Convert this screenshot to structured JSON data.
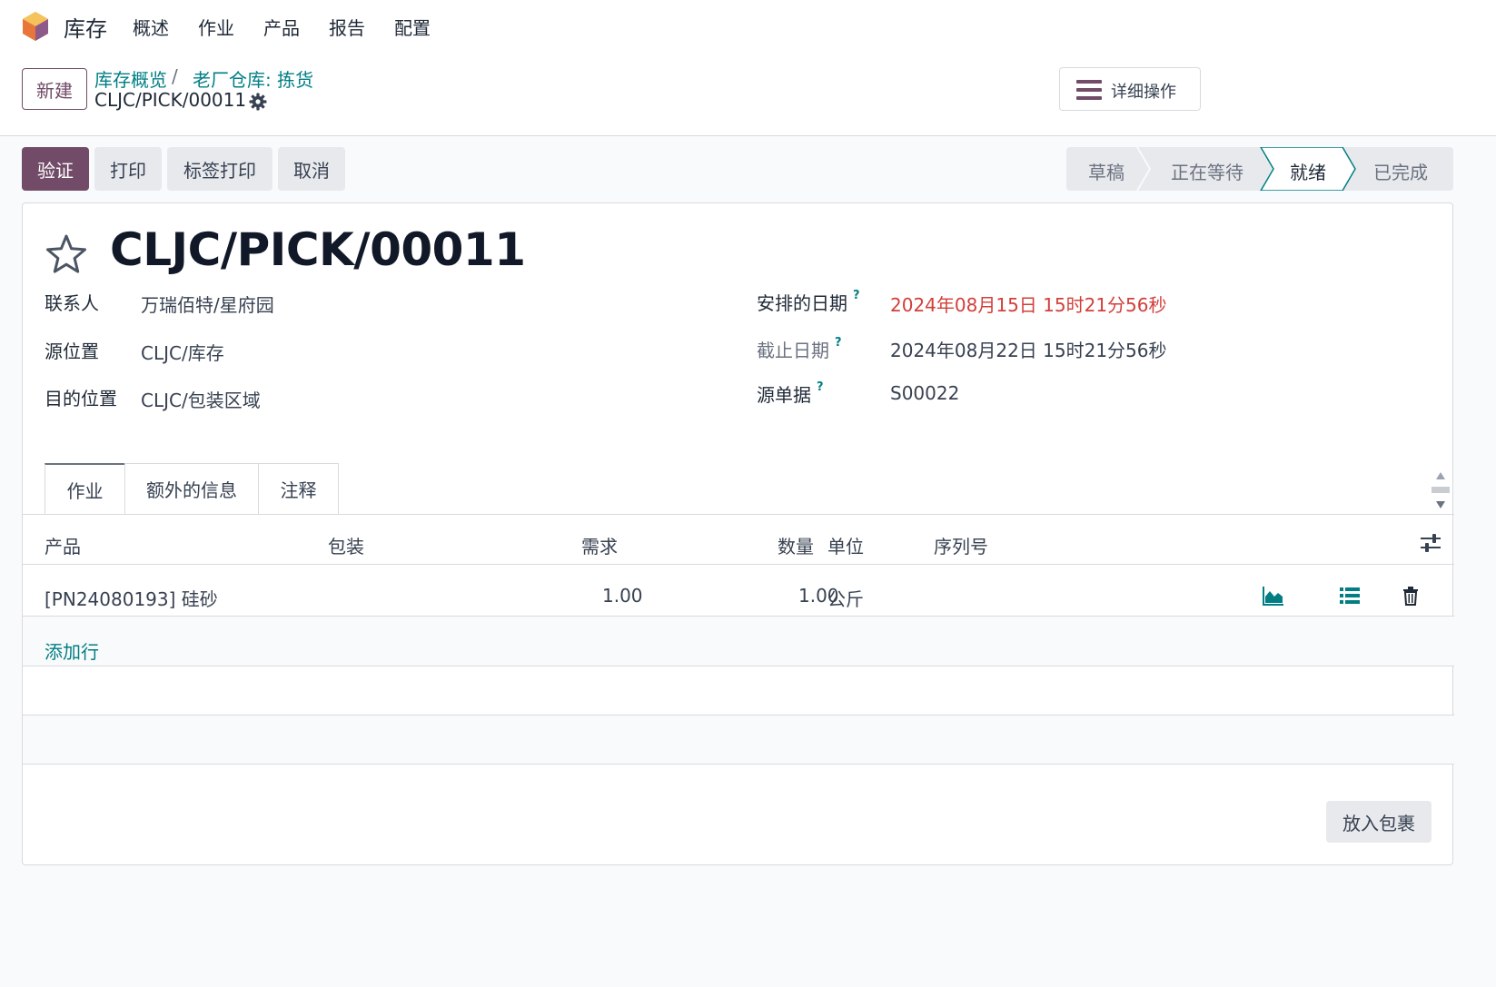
{
  "nav": {
    "app_name": "库存",
    "menu": [
      "概述",
      "作业",
      "产品",
      "报告",
      "配置"
    ]
  },
  "control": {
    "new_label": "新建",
    "breadcrumb": [
      "库存概览",
      "老厂仓库: 拣货"
    ],
    "breadcrumb_sep": "/",
    "current": "CLJC/PICK/00011",
    "actions_label": "详细操作"
  },
  "buttons": {
    "validate": "验证",
    "print": "打印",
    "label_print": "标签打印",
    "cancel": "取消"
  },
  "status": {
    "stages": [
      "草稿",
      "正在等待",
      "就绪",
      "已完成"
    ],
    "active": "就绪"
  },
  "record": {
    "title": "CLJC/PICK/00011",
    "fields_left": [
      {
        "label": "联系人",
        "value": "万瑞佰特/星府园"
      },
      {
        "label": "源位置",
        "value": "CLJC/库存"
      },
      {
        "label": "目的位置",
        "value": "CLJC/包装区域"
      }
    ],
    "fields_right": [
      {
        "label": "安排的日期",
        "value": "2024年08月15日 15时21分56秒",
        "help": "?"
      },
      {
        "label": "截止日期",
        "value": "2024年08月22日 15时21分56秒",
        "help": "?"
      },
      {
        "label": "源单据",
        "value": "S00022",
        "help": "?"
      }
    ]
  },
  "tabs": [
    "作业",
    "额外的信息",
    "注释"
  ],
  "table": {
    "headers": [
      "产品",
      "包装",
      "需求",
      "数量",
      "单位",
      "序列号"
    ],
    "rows": [
      {
        "product": "[PN24080193] 硅砂",
        "packaging": "",
        "demand": "1.00",
        "quantity": "1.00",
        "uom": "公斤",
        "serial": ""
      }
    ],
    "add_line": "添加行"
  },
  "footer": {
    "put_in_pack": "放入包裹"
  },
  "colors": {
    "primary": "#714b67",
    "link": "#017e84",
    "overdue": "#d23f3a",
    "active_stage_border": "#017e84"
  }
}
